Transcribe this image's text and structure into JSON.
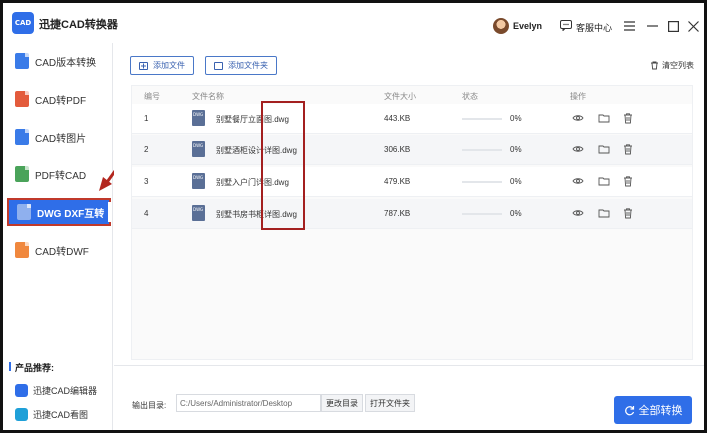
{
  "app": {
    "logo_text": "CAD",
    "title": "迅捷CAD转换器"
  },
  "user": {
    "name": "Evelyn"
  },
  "header": {
    "service_label": "客服中心"
  },
  "sidebar": {
    "items": [
      {
        "label": "CAD版本转换",
        "color": "#3a7be8"
      },
      {
        "label": "CAD转PDF",
        "color": "#e35b3c"
      },
      {
        "label": "CAD转图片",
        "color": "#3a7be8"
      },
      {
        "label": "PDF转CAD",
        "color": "#4aa35a"
      },
      {
        "label": "DWG DXF互转",
        "color": "#6a8fd8"
      },
      {
        "label": "CAD转DWF",
        "color": "#f0883e"
      }
    ],
    "active_index": 4,
    "recommend_title": "产品推荐:",
    "recommend": [
      {
        "label": "迅捷CAD编辑器",
        "color": "#2f6ee8"
      },
      {
        "label": "迅捷CAD看图",
        "color": "#1fa0d8"
      }
    ]
  },
  "toolbar": {
    "add_file": "添加文件",
    "add_folder": "添加文件夹",
    "clear_list": "清空列表"
  },
  "table": {
    "headers": {
      "num": "编号",
      "name": "文件名称",
      "size": "文件大小",
      "status": "状态",
      "actions": "操作"
    },
    "rows": [
      {
        "num": "1",
        "name": "别墅餐厅立面图.dwg",
        "size": "443.KB",
        "progress": 0,
        "progress_text": "0%"
      },
      {
        "num": "2",
        "name": "别墅酒柜设计详图.dwg",
        "size": "306.KB",
        "progress": 0,
        "progress_text": "0%"
      },
      {
        "num": "3",
        "name": "别墅入户门详图.dwg",
        "size": "479.KB",
        "progress": 0,
        "progress_text": "0%"
      },
      {
        "num": "4",
        "name": "别墅书房书柜详图.dwg",
        "size": "787.KB",
        "progress": 0,
        "progress_text": "0%"
      }
    ]
  },
  "output": {
    "label": "输出目录:",
    "path": "C:/Users/Administrator/Desktop",
    "change_dir": "更改目录",
    "open_folder": "打开文件夹"
  },
  "convert_all": "全部转换",
  "colors": {
    "accent": "#2f6ee8",
    "annotation": "#a31f1f"
  }
}
